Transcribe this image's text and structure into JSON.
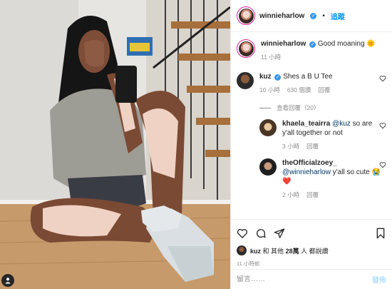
{
  "post": {
    "author": "winnieharlow",
    "follow_label": "追蹤",
    "caption_text": "Good moaning",
    "caption_emoji": "🌞",
    "caption_time": "11 小時"
  },
  "comments": {
    "top": {
      "user": "kuz",
      "text": "Shes a B U Tee",
      "time": "10 小時",
      "likes": "630 個讚",
      "reply": "回覆"
    },
    "view_replies": "查看回覆（20）",
    "replies": [
      {
        "user": "khaela_teairra",
        "mention": "@kuz",
        "text": "so are y'all together or not",
        "time": "3 小時",
        "reply": "回覆"
      },
      {
        "user": "theOfficialzoey_",
        "mention": "@winnieharlow",
        "text": "y'all so cute",
        "emoji": "😭❤️",
        "time": "2 小時",
        "reply": "回覆"
      }
    ]
  },
  "likes_bar": {
    "liker": "kuz",
    "text_mid": "和 其他",
    "count": "28萬",
    "text_end": "人 都說讚"
  },
  "post_time": "11 小時前",
  "composer": {
    "placeholder": "留言……",
    "post_label": "發佈"
  },
  "colors": {
    "link": "#0095f6",
    "heart_red": "#ed4956",
    "verified": "#3897f0",
    "muted": "#8e8e8e"
  }
}
